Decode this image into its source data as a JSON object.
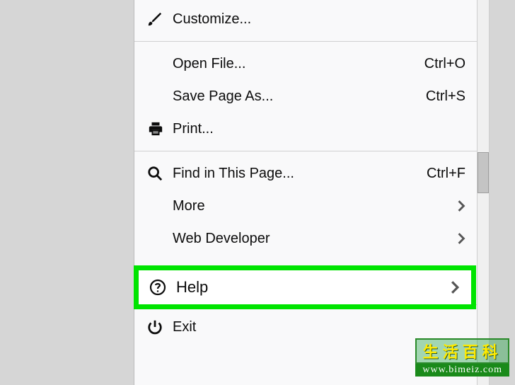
{
  "menu": {
    "customize": {
      "label": "Customize..."
    },
    "openFile": {
      "label": "Open File...",
      "shortcut": "Ctrl+O"
    },
    "savePageAs": {
      "label": "Save Page As...",
      "shortcut": "Ctrl+S"
    },
    "print": {
      "label": "Print..."
    },
    "findInPage": {
      "label": "Find in This Page...",
      "shortcut": "Ctrl+F"
    },
    "more": {
      "label": "More"
    },
    "webDeveloper": {
      "label": "Web Developer"
    },
    "help": {
      "label": "Help"
    },
    "exit": {
      "label": "Exit"
    }
  },
  "watermark": {
    "top": "生活百科",
    "bottom": "www.bimeiz.com"
  }
}
